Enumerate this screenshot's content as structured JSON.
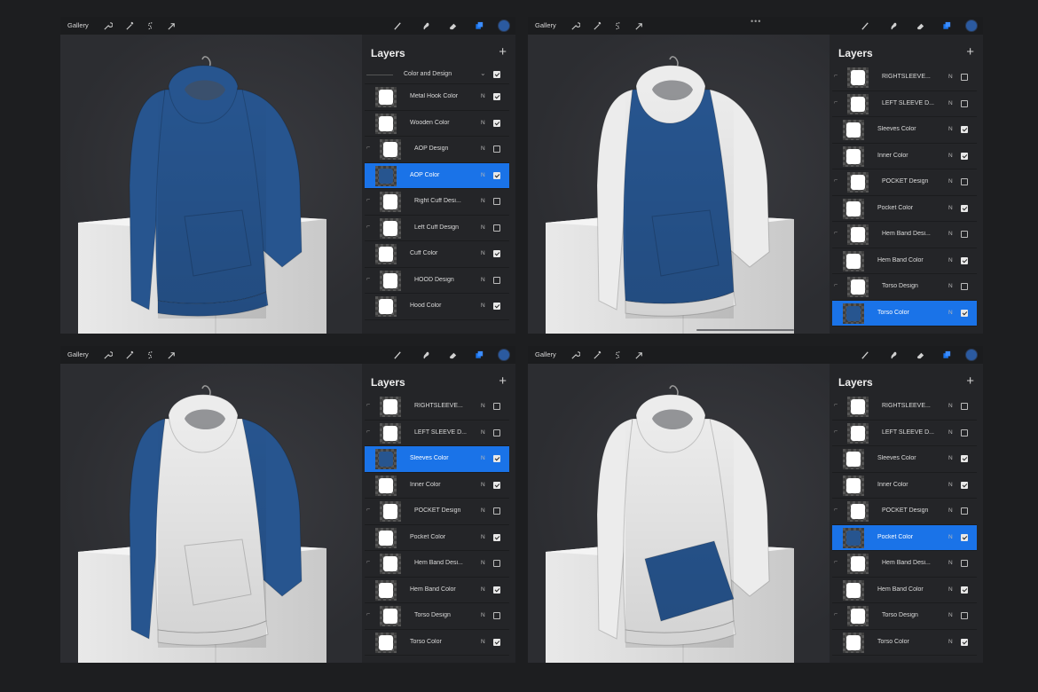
{
  "colors": {
    "accent": "#1a73e8",
    "garment_blue": "#27558f",
    "garment_white": "#ececec"
  },
  "toolbar": {
    "gallery": "Gallery",
    "left_icons": [
      "wrench-icon",
      "magic-wand-icon",
      "selection-s-icon",
      "arrow-cursor-icon"
    ],
    "right_icons": [
      "brush-icon",
      "smudge-icon",
      "eraser-icon",
      "layers-icon"
    ],
    "color_swatch": "#2b5aa0",
    "more_dots": "•••"
  },
  "panels": [
    {
      "highlight": "all",
      "layers_title": "Layers",
      "add": "+",
      "group": {
        "name": "Color and Design",
        "checked": true
      },
      "rows": [
        {
          "name": "Metal Hook Color",
          "blend": "N",
          "checked": true,
          "selected": false,
          "kind": "color"
        },
        {
          "name": "Wooden Color",
          "blend": "N",
          "checked": true,
          "selected": false,
          "kind": "color"
        },
        {
          "name": "AOP Design",
          "blend": "N",
          "checked": false,
          "selected": false,
          "kind": "design"
        },
        {
          "name": "AOP Color",
          "blend": "N",
          "checked": true,
          "selected": true,
          "kind": "color"
        },
        {
          "name": "Right Cuff Desi...",
          "blend": "N",
          "checked": false,
          "selected": false,
          "kind": "design"
        },
        {
          "name": "Left Cuff Design",
          "blend": "N",
          "checked": false,
          "selected": false,
          "kind": "design"
        },
        {
          "name": "Cuff Color",
          "blend": "N",
          "checked": true,
          "selected": false,
          "kind": "color"
        },
        {
          "name": "HOOD Design",
          "blend": "N",
          "checked": false,
          "selected": false,
          "kind": "design"
        },
        {
          "name": "Hood Color",
          "blend": "N",
          "checked": true,
          "selected": false,
          "kind": "color"
        }
      ]
    },
    {
      "highlight": "torso",
      "layers_title": "Layers",
      "add": "+",
      "rows": [
        {
          "name": "RIGHTSLEEVE...",
          "blend": "N",
          "checked": false,
          "selected": false,
          "kind": "design"
        },
        {
          "name": "LEFT SLEEVE D...",
          "blend": "N",
          "checked": false,
          "selected": false,
          "kind": "design"
        },
        {
          "name": "Sleeves Color",
          "blend": "N",
          "checked": true,
          "selected": false,
          "kind": "color"
        },
        {
          "name": "Inner Color",
          "blend": "N",
          "checked": true,
          "selected": false,
          "kind": "color"
        },
        {
          "name": "POCKET Design",
          "blend": "N",
          "checked": false,
          "selected": false,
          "kind": "design"
        },
        {
          "name": "Pocket Color",
          "blend": "N",
          "checked": true,
          "selected": false,
          "kind": "color"
        },
        {
          "name": "Hem Band Desi...",
          "blend": "N",
          "checked": false,
          "selected": false,
          "kind": "design"
        },
        {
          "name": "Hem Band Color",
          "blend": "N",
          "checked": true,
          "selected": false,
          "kind": "color"
        },
        {
          "name": "Torso Design",
          "blend": "N",
          "checked": false,
          "selected": false,
          "kind": "design"
        },
        {
          "name": "Torso Color",
          "blend": "N",
          "checked": true,
          "selected": true,
          "kind": "color"
        }
      ]
    },
    {
      "highlight": "sleeves",
      "layers_title": "Layers",
      "add": "+",
      "rows": [
        {
          "name": "RIGHTSLEEVE...",
          "blend": "N",
          "checked": false,
          "selected": false,
          "kind": "design"
        },
        {
          "name": "LEFT SLEEVE D...",
          "blend": "N",
          "checked": false,
          "selected": false,
          "kind": "design"
        },
        {
          "name": "Sleeves Color",
          "blend": "N",
          "checked": true,
          "selected": true,
          "kind": "color"
        },
        {
          "name": "Inner Color",
          "blend": "N",
          "checked": true,
          "selected": false,
          "kind": "color"
        },
        {
          "name": "POCKET Design",
          "blend": "N",
          "checked": false,
          "selected": false,
          "kind": "design"
        },
        {
          "name": "Pocket Color",
          "blend": "N",
          "checked": true,
          "selected": false,
          "kind": "color"
        },
        {
          "name": "Hem Band Desi...",
          "blend": "N",
          "checked": false,
          "selected": false,
          "kind": "design"
        },
        {
          "name": "Hem Band Color",
          "blend": "N",
          "checked": true,
          "selected": false,
          "kind": "color"
        },
        {
          "name": "Torso Design",
          "blend": "N",
          "checked": false,
          "selected": false,
          "kind": "design"
        },
        {
          "name": "Torso Color",
          "blend": "N",
          "checked": true,
          "selected": false,
          "kind": "color"
        }
      ]
    },
    {
      "highlight": "pocket",
      "layers_title": "Layers",
      "add": "+",
      "rows": [
        {
          "name": "RIGHTSLEEVE...",
          "blend": "N",
          "checked": false,
          "selected": false,
          "kind": "design"
        },
        {
          "name": "LEFT SLEEVE D...",
          "blend": "N",
          "checked": false,
          "selected": false,
          "kind": "design"
        },
        {
          "name": "Sleeves Color",
          "blend": "N",
          "checked": true,
          "selected": false,
          "kind": "color"
        },
        {
          "name": "Inner Color",
          "blend": "N",
          "checked": true,
          "selected": false,
          "kind": "color"
        },
        {
          "name": "POCKET Design",
          "blend": "N",
          "checked": false,
          "selected": false,
          "kind": "design"
        },
        {
          "name": "Pocket Color",
          "blend": "N",
          "checked": true,
          "selected": true,
          "kind": "color"
        },
        {
          "name": "Hem Band Desi...",
          "blend": "N",
          "checked": false,
          "selected": false,
          "kind": "design"
        },
        {
          "name": "Hem Band Color",
          "blend": "N",
          "checked": true,
          "selected": false,
          "kind": "color"
        },
        {
          "name": "Torso Design",
          "blend": "N",
          "checked": false,
          "selected": false,
          "kind": "design"
        },
        {
          "name": "Torso Color",
          "blend": "N",
          "checked": true,
          "selected": false,
          "kind": "color"
        }
      ]
    }
  ]
}
